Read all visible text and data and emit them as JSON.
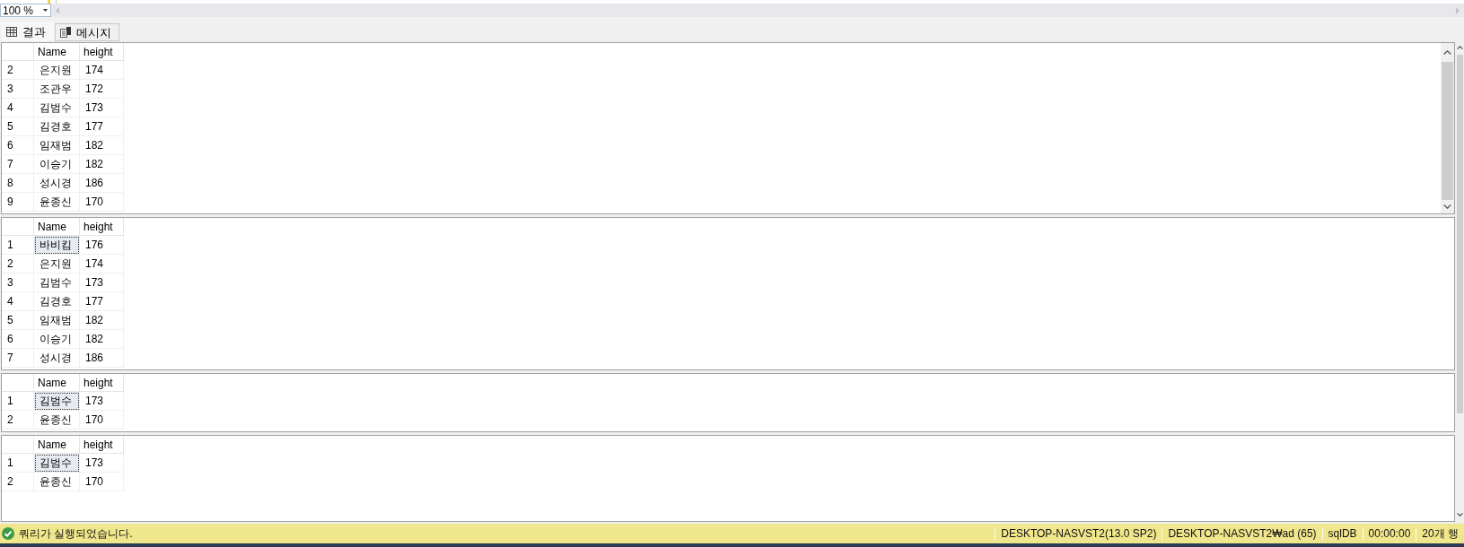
{
  "editor": {
    "zoom": {
      "value": "100 %"
    }
  },
  "tabs": [
    {
      "label": "결과",
      "kind": "grid",
      "selected": true
    },
    {
      "label": "메시지",
      "kind": "messages",
      "selected": false
    }
  ],
  "result_sets": [
    {
      "columns": [
        "Name",
        "height"
      ],
      "scrollbar": true,
      "rows": [
        {
          "number": "2",
          "cells": [
            {
              "text": "은지원",
              "selected": false
            },
            {
              "text": "174",
              "selected": false
            }
          ]
        },
        {
          "number": "3",
          "cells": [
            {
              "text": "조관우",
              "selected": false
            },
            {
              "text": "172",
              "selected": false
            }
          ]
        },
        {
          "number": "4",
          "cells": [
            {
              "text": "김범수",
              "selected": false
            },
            {
              "text": "173",
              "selected": false
            }
          ]
        },
        {
          "number": "5",
          "cells": [
            {
              "text": "김경호",
              "selected": false
            },
            {
              "text": "177",
              "selected": false
            }
          ]
        },
        {
          "number": "6",
          "cells": [
            {
              "text": "임재범",
              "selected": false
            },
            {
              "text": "182",
              "selected": false
            }
          ]
        },
        {
          "number": "7",
          "cells": [
            {
              "text": "이승기",
              "selected": false
            },
            {
              "text": "182",
              "selected": false
            }
          ]
        },
        {
          "number": "8",
          "cells": [
            {
              "text": "성시경",
              "selected": false
            },
            {
              "text": "186",
              "selected": false
            }
          ]
        },
        {
          "number": "9",
          "cells": [
            {
              "text": "윤종신",
              "selected": false
            },
            {
              "text": "170",
              "selected": false
            }
          ]
        }
      ]
    },
    {
      "columns": [
        "Name",
        "height"
      ],
      "scrollbar": false,
      "rows": [
        {
          "number": "1",
          "cells": [
            {
              "text": "바비킴",
              "selected": true
            },
            {
              "text": "176",
              "selected": false
            }
          ]
        },
        {
          "number": "2",
          "cells": [
            {
              "text": "은지원",
              "selected": false
            },
            {
              "text": "174",
              "selected": false
            }
          ]
        },
        {
          "number": "3",
          "cells": [
            {
              "text": "김범수",
              "selected": false
            },
            {
              "text": "173",
              "selected": false
            }
          ]
        },
        {
          "number": "4",
          "cells": [
            {
              "text": "김경호",
              "selected": false
            },
            {
              "text": "177",
              "selected": false
            }
          ]
        },
        {
          "number": "5",
          "cells": [
            {
              "text": "임재범",
              "selected": false
            },
            {
              "text": "182",
              "selected": false
            }
          ]
        },
        {
          "number": "6",
          "cells": [
            {
              "text": "이승기",
              "selected": false
            },
            {
              "text": "182",
              "selected": false
            }
          ]
        },
        {
          "number": "7",
          "cells": [
            {
              "text": "성시경",
              "selected": false
            },
            {
              "text": "186",
              "selected": false
            }
          ]
        }
      ]
    },
    {
      "columns": [
        "Name",
        "height"
      ],
      "scrollbar": false,
      "rows": [
        {
          "number": "1",
          "cells": [
            {
              "text": "김범수",
              "selected": true
            },
            {
              "text": "173",
              "selected": false
            }
          ]
        },
        {
          "number": "2",
          "cells": [
            {
              "text": "윤종신",
              "selected": false
            },
            {
              "text": "170",
              "selected": false
            }
          ]
        }
      ]
    },
    {
      "columns": [
        "Name",
        "height"
      ],
      "scrollbar": false,
      "rows": [
        {
          "number": "1",
          "cells": [
            {
              "text": "김범수",
              "selected": true
            },
            {
              "text": "173",
              "selected": false
            }
          ]
        },
        {
          "number": "2",
          "cells": [
            {
              "text": "윤종신",
              "selected": false
            },
            {
              "text": "170",
              "selected": false
            }
          ]
        }
      ]
    }
  ],
  "status_bar": {
    "kind": "success",
    "message": "쿼리가 실행되었습니다.",
    "sections": [
      "DESKTOP-NASVST2(13.0 SP2)",
      "DESKTOP-NASVST2₩ad (65)",
      "sqlDB",
      "00:00:00",
      "20개 행"
    ]
  }
}
